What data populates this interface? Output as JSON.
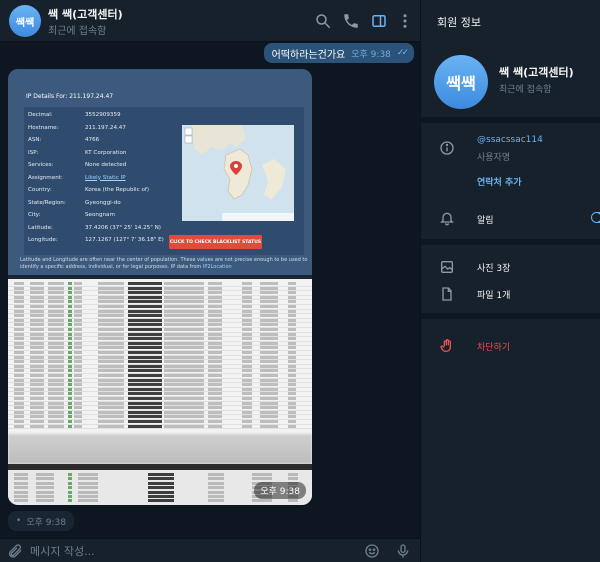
{
  "chat": {
    "title": "쌕 쌕(고객센터)",
    "status": "최근에 접속함",
    "avatar_text": "쌕쌕",
    "outgoing": {
      "text": "어떡하라는건가요",
      "time": "오후 9:38",
      "read": "✓✓"
    },
    "image_time": "오후 9:38",
    "incoming_time": "오후 9:38",
    "incoming_dot": "•",
    "composer_placeholder": "메시지 작성..."
  },
  "ip_details": {
    "title": "IP Details For: 211.197.24.47",
    "rows": [
      {
        "k": "Decimal:",
        "v": "3552909359"
      },
      {
        "k": "Hostname:",
        "v": "211.197.24.47"
      },
      {
        "k": "ASN:",
        "v": "4766"
      },
      {
        "k": "ISP:",
        "v": "KT Corporation"
      },
      {
        "k": "Services:",
        "v": "None detected"
      },
      {
        "k": "Assignment:",
        "v": "Likely Static IP"
      },
      {
        "k": "Country:",
        "v": "Korea (the Republic of)"
      },
      {
        "k": "State/Region:",
        "v": "Gyeonggi-do"
      },
      {
        "k": "City:",
        "v": "Seongnam"
      },
      {
        "k": "Latitude:",
        "v": "37.4206 (37° 25' 14.25\" N)"
      },
      {
        "k": "Longitude:",
        "v": "127.1267 (127° 7' 36.18\" E)"
      }
    ],
    "button": "CLICK TO CHECK BLACKLIST STATUS",
    "note": "Latitude and Longitude are often near the center of population. These values are not precise enough to be used to identify a specific address, individual, or for legal purposes. IP data from",
    "note_link": "IP2Location",
    "map_credit": "Leaflet | © OpenStreetMap Terms"
  },
  "info": {
    "title": "회원 정보",
    "avatar_text": "쌕쌕",
    "name": "쌕 쌕(고객센터)",
    "status": "최근에 접속함",
    "username": "@ssacssac114",
    "username_label": "사용자명",
    "add_contact": "연락처 추가",
    "notifications": "알림",
    "notifications_on": true,
    "photos": "사진 3장",
    "files": "파일 1개",
    "block": "차단하기"
  },
  "colors": {
    "accent": "#6ab3f3",
    "outgoing_bubble": "#2b5278",
    "danger": "#e5534b",
    "bg": "#0e1621",
    "panel": "#17212b"
  }
}
